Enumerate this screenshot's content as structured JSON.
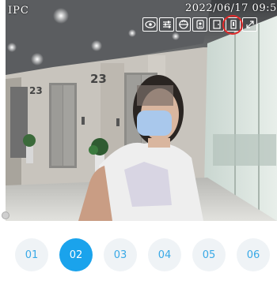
{
  "camera": {
    "label": "IPC",
    "timestamp": "2022/06/17 09:5",
    "floor_numbers": [
      "23",
      "23"
    ],
    "toolbar": [
      {
        "name": "view-icon"
      },
      {
        "name": "settings-sliders-icon"
      },
      {
        "name": "flip-icon"
      },
      {
        "name": "intercom-icon"
      },
      {
        "name": "door-icon"
      },
      {
        "name": "unlock-icon",
        "highlighted": true
      },
      {
        "name": "fullscreen-icon"
      }
    ],
    "highlight_color": "#e02a2a"
  },
  "channels": {
    "items": [
      "01",
      "02",
      "03",
      "04",
      "05",
      "06"
    ],
    "active_index": 1,
    "active_color": "#1aa3ec",
    "inactive_background": "#eff3f6",
    "text_color": "#39a9e6"
  }
}
